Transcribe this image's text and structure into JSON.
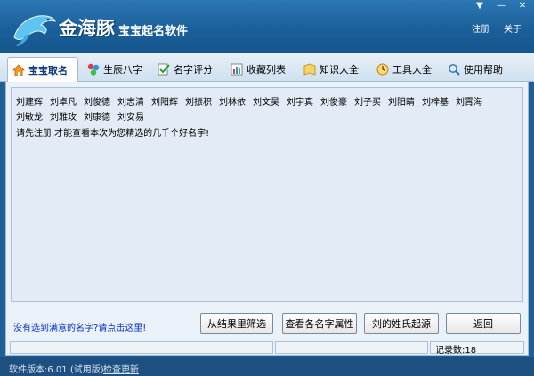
{
  "app": {
    "brand": "金海豚",
    "subtitle": "宝宝起名软件",
    "header_links": [
      "注册",
      "关于"
    ],
    "window_controls": [
      "▼",
      "—",
      "✕"
    ]
  },
  "tabs": [
    {
      "label": "宝宝取名",
      "icon": "home-icon",
      "active": true
    },
    {
      "label": "生辰八字",
      "icon": "balls-icon",
      "active": false
    },
    {
      "label": "名字评分",
      "icon": "score-icon",
      "active": false
    },
    {
      "label": "收藏列表",
      "icon": "chart-icon",
      "active": false
    },
    {
      "label": "知识大全",
      "icon": "book-icon",
      "active": false
    },
    {
      "label": "工具大全",
      "icon": "clock-icon",
      "active": false
    },
    {
      "label": "使用帮助",
      "icon": "magnifier-icon",
      "active": false
    }
  ],
  "results": {
    "names": [
      "刘建辉",
      "刘卓凡",
      "刘俊德",
      "刘志清",
      "刘阳辉",
      "刘振积",
      "刘林依",
      "刘文昊",
      "刘宇真",
      "刘俊豪",
      "刘子买",
      "刘阳睛",
      "刘梓基",
      "刘霄海",
      "刘敏龙",
      "刘雅玫",
      "刘康德",
      "刘安易"
    ],
    "notice": "请先注册,才能查看本次为您精选的几千个好名字!"
  },
  "actions": {
    "unsatisfied_link": "没有选到满意的名字?请点击这里!",
    "filter_button": "从结果里筛选",
    "attributes_button": "查看各名字属性",
    "surname_origin_button": "刘的姓氏起源",
    "back_button": "返回"
  },
  "status": {
    "record_count": "记录数:18"
  },
  "footer": {
    "version": "软件版本:6.01 (试用版)",
    "check_update": "检查更新"
  }
}
